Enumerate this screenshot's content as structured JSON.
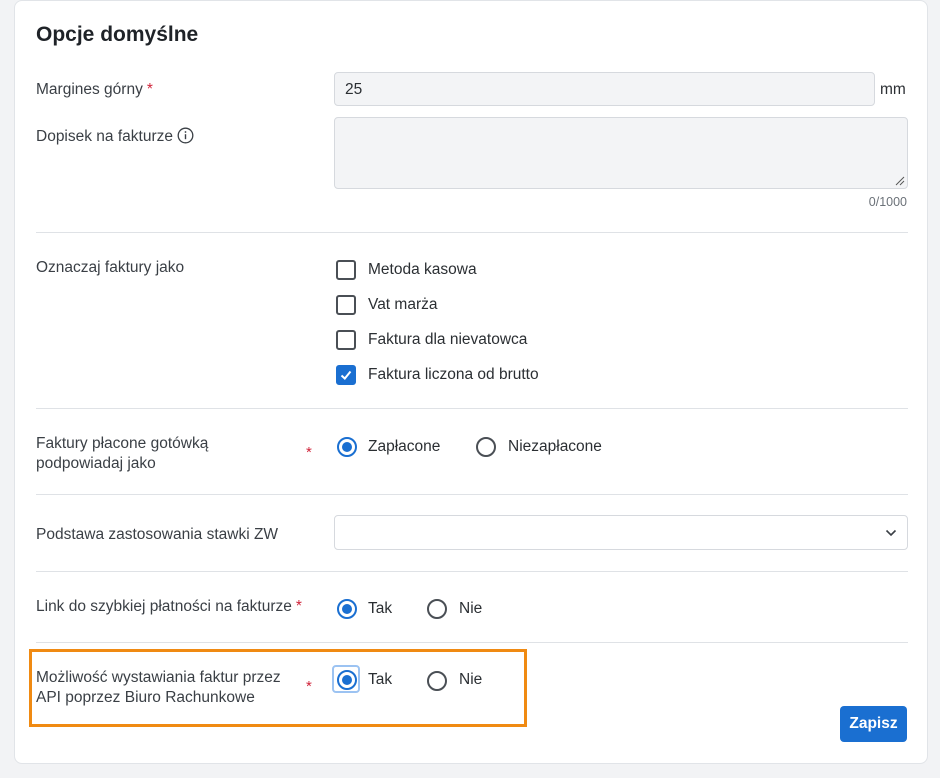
{
  "section": {
    "title": "Opcje domyślne"
  },
  "margin": {
    "label": "Margines górny",
    "required": "*",
    "value": "25",
    "unit": "mm"
  },
  "note": {
    "label": "Dopisek na fakturze",
    "counter": "0/1000",
    "icon": "info-icon"
  },
  "mark_invoices": {
    "label": "Oznaczaj faktury jako",
    "options": [
      {
        "label": "Metoda kasowa",
        "checked": false
      },
      {
        "label": "Vat marża",
        "checked": false
      },
      {
        "label": "Faktura dla nievatowca",
        "checked": false
      },
      {
        "label": "Faktura liczona od brutto",
        "checked": true
      }
    ]
  },
  "cash_paid": {
    "label_line1": "Faktury płacone gotówką",
    "label_line2": "podpowiadaj jako",
    "required": "*",
    "options": [
      "Zapłacone",
      "Niezapłacone"
    ],
    "selected": "Zapłacone"
  },
  "zw_basis": {
    "label": "Podstawa zastosowania stawki ZW",
    "value": ""
  },
  "quick_payment": {
    "label": "Link do szybkiej płatności na fakturze",
    "required": "*",
    "options": [
      "Tak",
      "Nie"
    ],
    "selected": "Tak"
  },
  "api_invoicing": {
    "label_line1": "Możliwość wystawiania faktur przez",
    "label_line2": "API poprzez Biuro Rachunkowe",
    "required": "*",
    "options": [
      "Tak",
      "Nie"
    ],
    "selected": "Tak"
  },
  "actions": {
    "save": "Zapisz"
  },
  "colors": {
    "accent": "#1a6fd1",
    "highlight": "#f08a12",
    "required": "#d0243a"
  }
}
